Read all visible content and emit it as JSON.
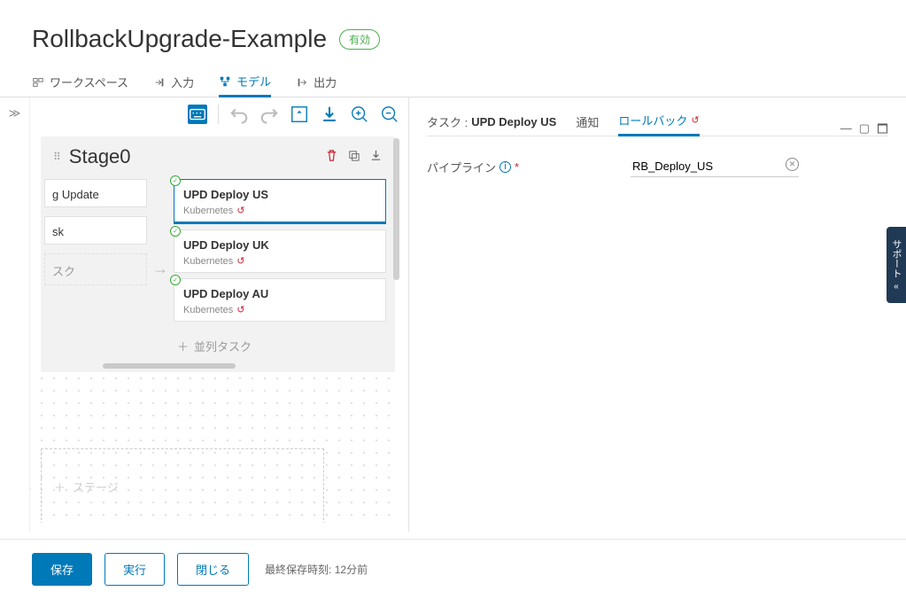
{
  "header": {
    "title": "RollbackUpgrade-Example",
    "status": "有効"
  },
  "tabs": {
    "workspace": "ワークスペース",
    "input": "入力",
    "model": "モデル",
    "output": "出力"
  },
  "canvas": {
    "stage_title": "Stage0",
    "left_cards": {
      "c0": "g Update",
      "c1": "sk",
      "c2": "スク"
    },
    "tasks": [
      {
        "name": "UPD Deploy US",
        "type": "Kubernetes"
      },
      {
        "name": "UPD Deploy UK",
        "type": "Kubernetes"
      },
      {
        "name": "UPD Deploy AU",
        "type": "Kubernetes"
      }
    ],
    "add_parallel": "並列タスク",
    "add_stage": "ステージ"
  },
  "detail": {
    "tab_task_prefix": "タスク :",
    "tab_task_name": "UPD Deploy US",
    "tab_notify": "通知",
    "tab_rollback": "ロールバック",
    "form": {
      "pipeline_label": "パイプライン",
      "pipeline_value": "RB_Deploy_US"
    }
  },
  "footer": {
    "save": "保存",
    "run": "実行",
    "close": "閉じる",
    "lastsave": "最終保存時刻: 12分前"
  },
  "support": "サポート"
}
